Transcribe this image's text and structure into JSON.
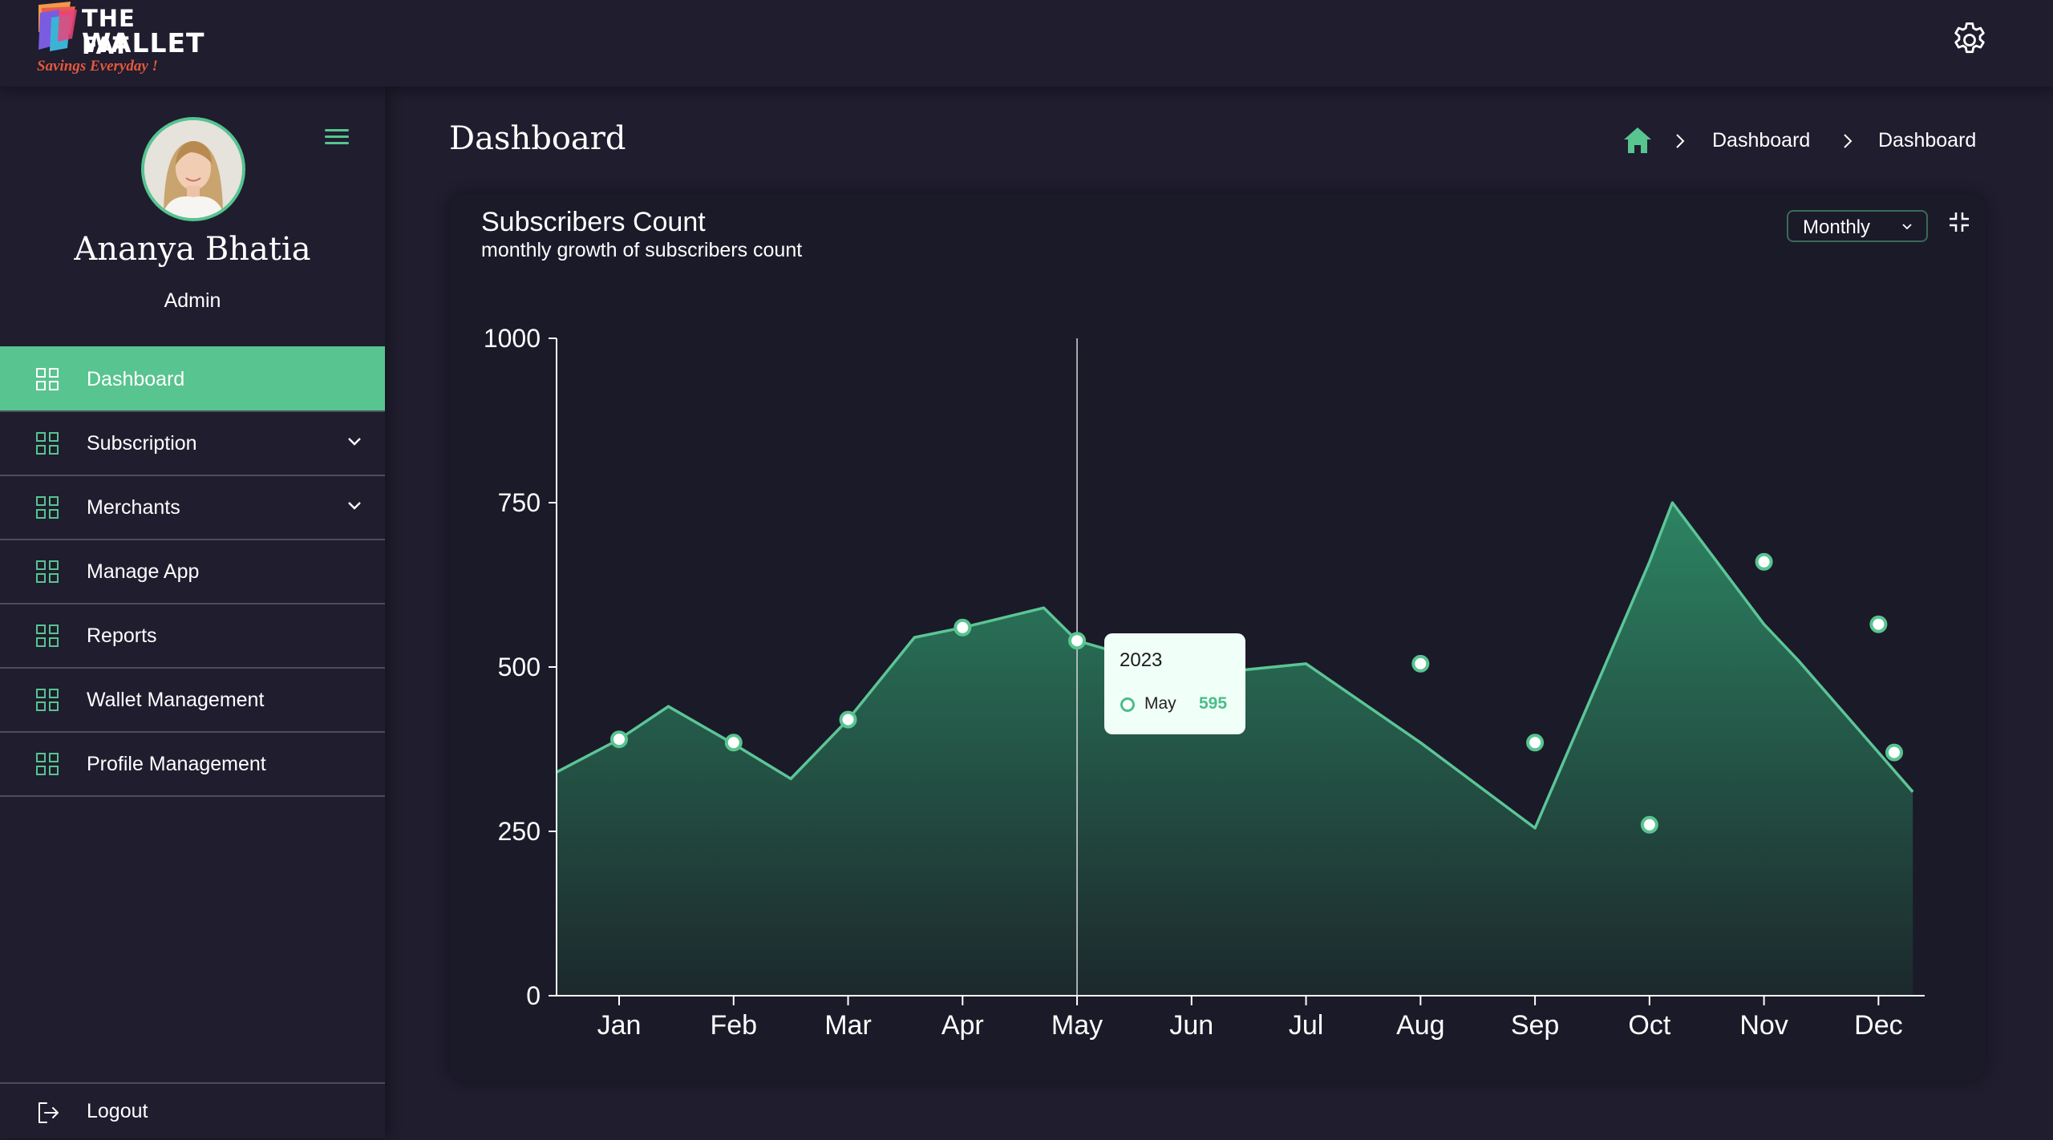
{
  "brand": {
    "line1": "THE FAT",
    "line2": "WALLET",
    "tagline": "Savings Everyday !"
  },
  "user": {
    "name": "Ananya Bhatia",
    "role": "Admin"
  },
  "nav": {
    "items": [
      {
        "label": "Dashboard",
        "active": true
      },
      {
        "label": "Subscription",
        "expandable": true
      },
      {
        "label": "Merchants",
        "expandable": true
      },
      {
        "label": "Manage App"
      },
      {
        "label": "Reports"
      },
      {
        "label": "Wallet Management"
      },
      {
        "label": "Profile Management"
      }
    ],
    "logout": "Logout"
  },
  "page": {
    "title": "Dashboard"
  },
  "breadcrumb": {
    "items": [
      "Dashboard",
      "Dashboard"
    ]
  },
  "card": {
    "title": "Subscribers Count",
    "subtitle": "monthly growth of subscribers count",
    "period": "Monthly"
  },
  "tooltip": {
    "year": "2023",
    "month": "May",
    "value": "595"
  },
  "colors": {
    "accent": "#58c48f",
    "background": "#1f1d2e",
    "card": "#1b1a29"
  },
  "chart_data": {
    "type": "area",
    "categories": [
      "Jan",
      "Feb",
      "Mar",
      "Apr",
      "May",
      "Jun",
      "Jul",
      "Aug",
      "Sep",
      "Oct",
      "Nov",
      "Dec"
    ],
    "yticks": [
      0,
      250,
      500,
      750,
      1000
    ],
    "ylim": [
      0,
      1000
    ],
    "line_x": [
      -0.55,
      0,
      0.43,
      0.98,
      1.5,
      2.0,
      2.58,
      3.0,
      3.71,
      4.0,
      4.3,
      5.42,
      6.0,
      7.0,
      8.0,
      9.0,
      9.2,
      10.0,
      10.3,
      11.0,
      11.3
    ],
    "line_y": [
      340,
      390,
      440,
      385,
      330,
      420,
      545,
      560,
      590,
      540,
      525,
      495,
      505,
      385,
      255,
      660,
      750,
      565,
      510,
      370,
      310
    ],
    "markers_x": [
      0,
      1,
      2,
      3,
      4,
      7,
      8,
      9,
      10,
      11,
      12
    ],
    "markers_y": [
      390,
      385,
      420,
      560,
      540,
      505,
      385,
      260,
      660,
      565,
      370
    ],
    "hover_index": 4,
    "grid": false,
    "legend": "none"
  }
}
